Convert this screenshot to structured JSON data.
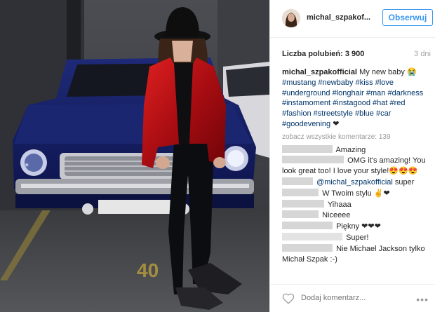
{
  "header": {
    "username": "michal_szpakof...",
    "follow_label": "Obserwuj"
  },
  "stats": {
    "likes": "Liczba polubień: 3 900",
    "time_ago": "3 dni"
  },
  "caption": {
    "user": "michal_szpakofficial",
    "text": "My new baby",
    "emoji": "😭",
    "hashtags": [
      "#mustang",
      "#newbaby",
      "#kiss",
      "#love",
      "#underground",
      "#longhair",
      "#man",
      "#darkness",
      "#instamoment",
      "#instagood",
      "#hat",
      "#red",
      "#fashion",
      "#streetstyle",
      "#blue",
      "#car",
      "#goodevening"
    ],
    "heart": "❤"
  },
  "view_all": "zobacz wszystkie komentarze: 139",
  "comments": [
    {
      "text": "Amazing"
    },
    {
      "text": "OMG it's amazing! You look great too! I love your style!😍😍😍"
    },
    {
      "mention": "@michal_szpakofficial",
      "text": "super"
    },
    {
      "text": "W Twoim stylu ✌❤"
    },
    {
      "text": "Yihaaa"
    },
    {
      "text": "Niceeee"
    },
    {
      "text": "Piękny ❤❤❤"
    },
    {
      "text": "Super!"
    },
    {
      "text": "Nie Michael Jackson tylko Michał Szpak :-)"
    }
  ],
  "footer": {
    "comment_placeholder": "Dodaj komentarz...",
    "more": "•••"
  },
  "photo": {
    "parking_number": "40"
  }
}
